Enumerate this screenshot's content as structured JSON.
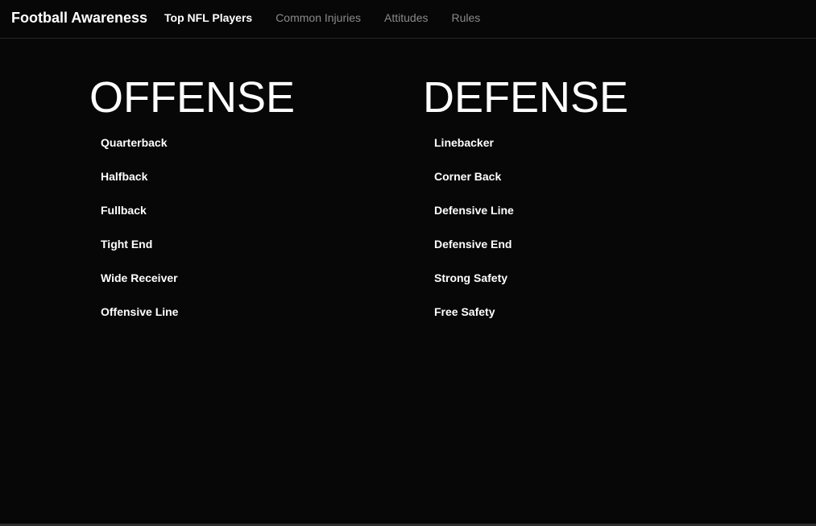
{
  "navbar": {
    "brand": "Football Awareness",
    "links": [
      {
        "label": "Top NFL Players",
        "active": true
      },
      {
        "label": "Common Injuries",
        "active": false
      },
      {
        "label": "Attitudes",
        "active": false
      },
      {
        "label": "Rules",
        "active": false
      }
    ]
  },
  "offense": {
    "title": "OFFENSE",
    "positions": [
      "Quarterback",
      "Halfback",
      "Fullback",
      "Tight End",
      "Wide Receiver",
      "Offensive Line"
    ]
  },
  "defense": {
    "title": "DEFENSE",
    "positions": [
      "Linebacker",
      "Corner Back",
      "Defensive Line",
      "Defensive End",
      "Strong Safety",
      "Free Safety"
    ]
  },
  "colors": {
    "background": "#070707",
    "text": "#ffffff",
    "nav_inactive": "#8a8a8a"
  }
}
